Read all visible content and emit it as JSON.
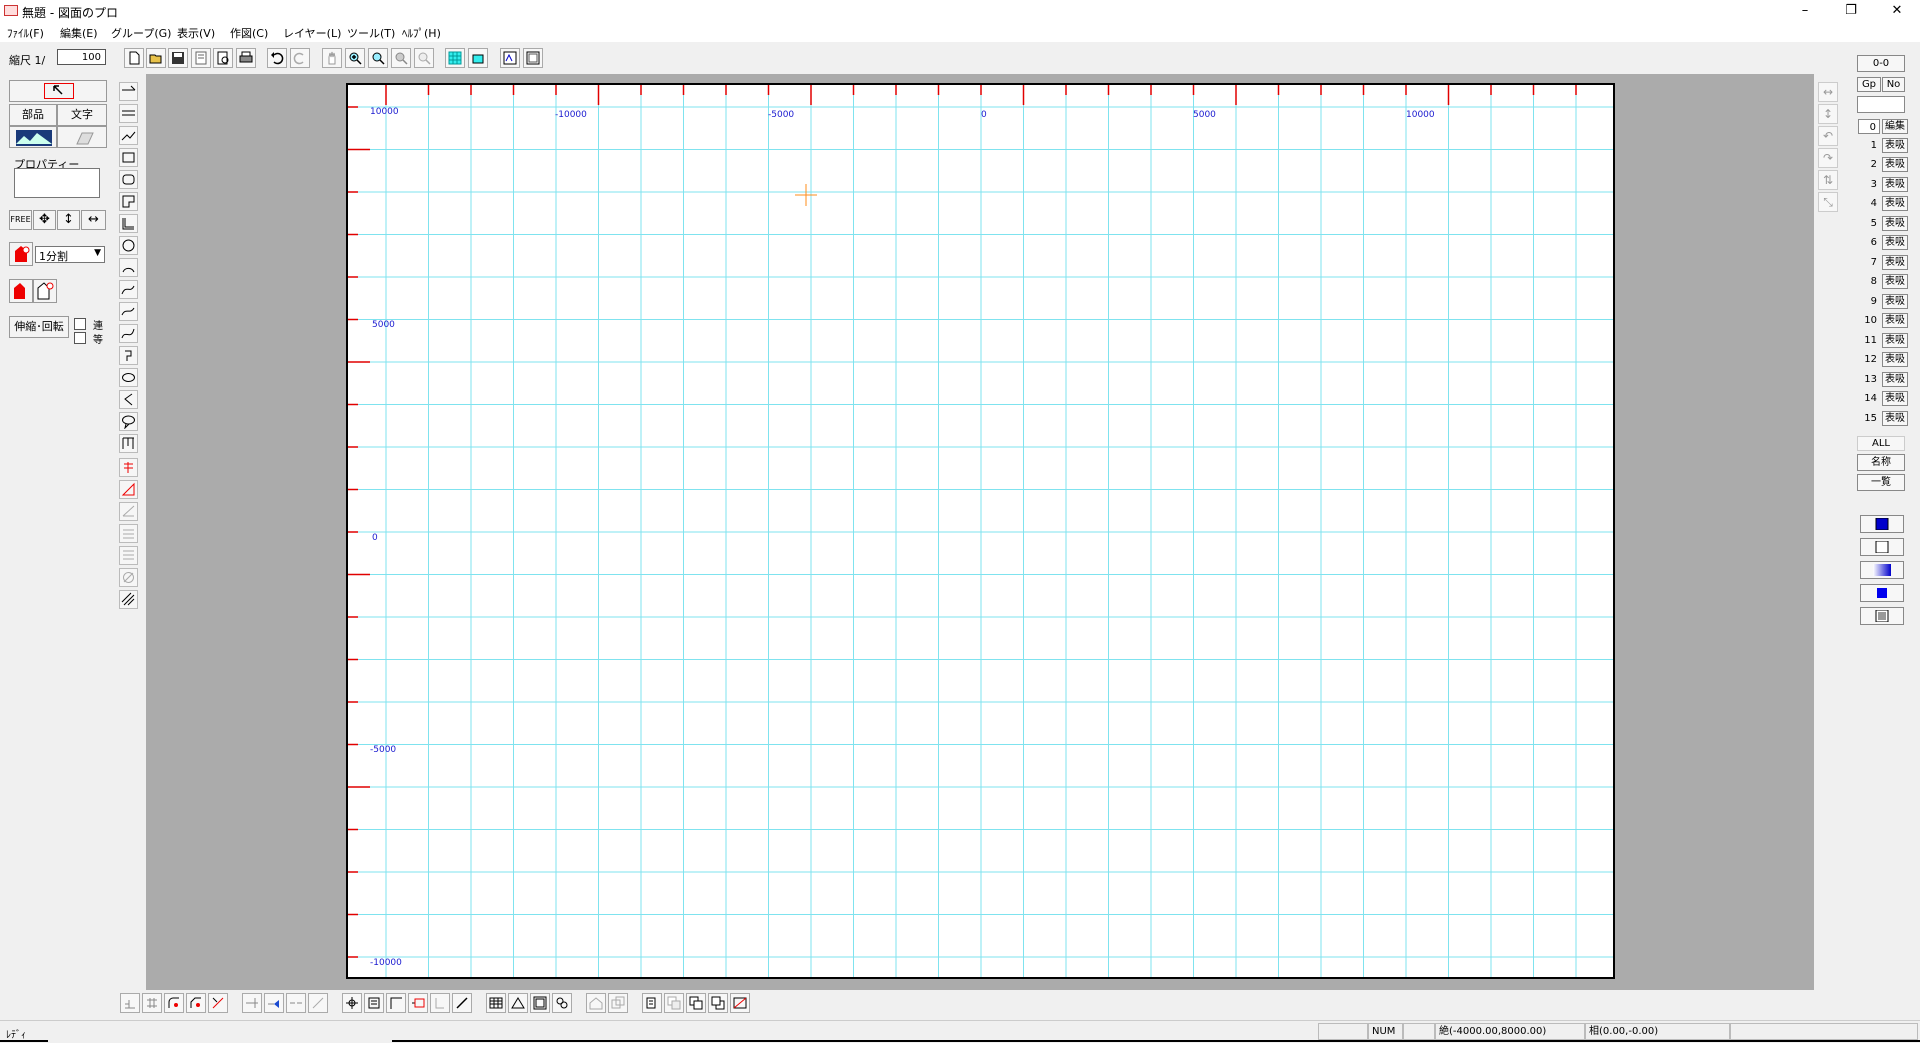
{
  "window": {
    "title": "無題 - 図面のプロ",
    "minimize": "–",
    "restore": "❐",
    "close": "✕"
  },
  "menu": [
    "ﾌｧｲﾙ(F)",
    "編集(E)",
    "グループ(G)",
    "表示(V)",
    "作図(C)",
    "レイヤー(L)",
    "ツール(T)",
    "ﾍﾙﾌﾟ(H)"
  ],
  "toolbar": {
    "scale_label": "縮尺  1/",
    "scale_value": "100"
  },
  "left_panel": {
    "parts_label": "部品",
    "text_label": "文字",
    "properties_label": "プロパティー",
    "free_label": "FREE",
    "division_value": "1分割",
    "stretch_rotate_label": "伸縮･回転",
    "continuous_label": "連",
    "equal_label": "等"
  },
  "ruler": {
    "top_labels": [
      "10000",
      "-10000",
      "-5000",
      "0",
      "5000",
      "10000"
    ],
    "left_labels": [
      "5000",
      "0",
      "-5000",
      "-10000"
    ]
  },
  "right_panel": {
    "top_value": "0-0",
    "gp_label": "Gp",
    "no_label": "No",
    "layers": [
      {
        "num": "0",
        "label": "編集"
      },
      {
        "num": "1",
        "label": "表吸"
      },
      {
        "num": "2",
        "label": "表吸"
      },
      {
        "num": "3",
        "label": "表吸"
      },
      {
        "num": "4",
        "label": "表吸"
      },
      {
        "num": "5",
        "label": "表吸"
      },
      {
        "num": "6",
        "label": "表吸"
      },
      {
        "num": "7",
        "label": "表吸"
      },
      {
        "num": "8",
        "label": "表吸"
      },
      {
        "num": "9",
        "label": "表吸"
      },
      {
        "num": "10",
        "label": "表吸"
      },
      {
        "num": "11",
        "label": "表吸"
      },
      {
        "num": "12",
        "label": "表吸"
      },
      {
        "num": "13",
        "label": "表吸"
      },
      {
        "num": "14",
        "label": "表吸"
      },
      {
        "num": "15",
        "label": "表吸"
      }
    ],
    "all_label": "ALL",
    "name_label": "名称",
    "list_label": "一覧"
  },
  "status": {
    "ready": "ﾚﾃﾞｨ",
    "num": "NUM",
    "absolute": "絶(-4000.00,8000.00)",
    "relative": "相(0.00,-0.00)"
  },
  "colors": {
    "grid": "#7fe3ef",
    "ruler_tick": "#e00000",
    "ruler_label": "#1a1ad0",
    "cursor": "#ff8c1a",
    "canvas_bg": "#ababab"
  }
}
